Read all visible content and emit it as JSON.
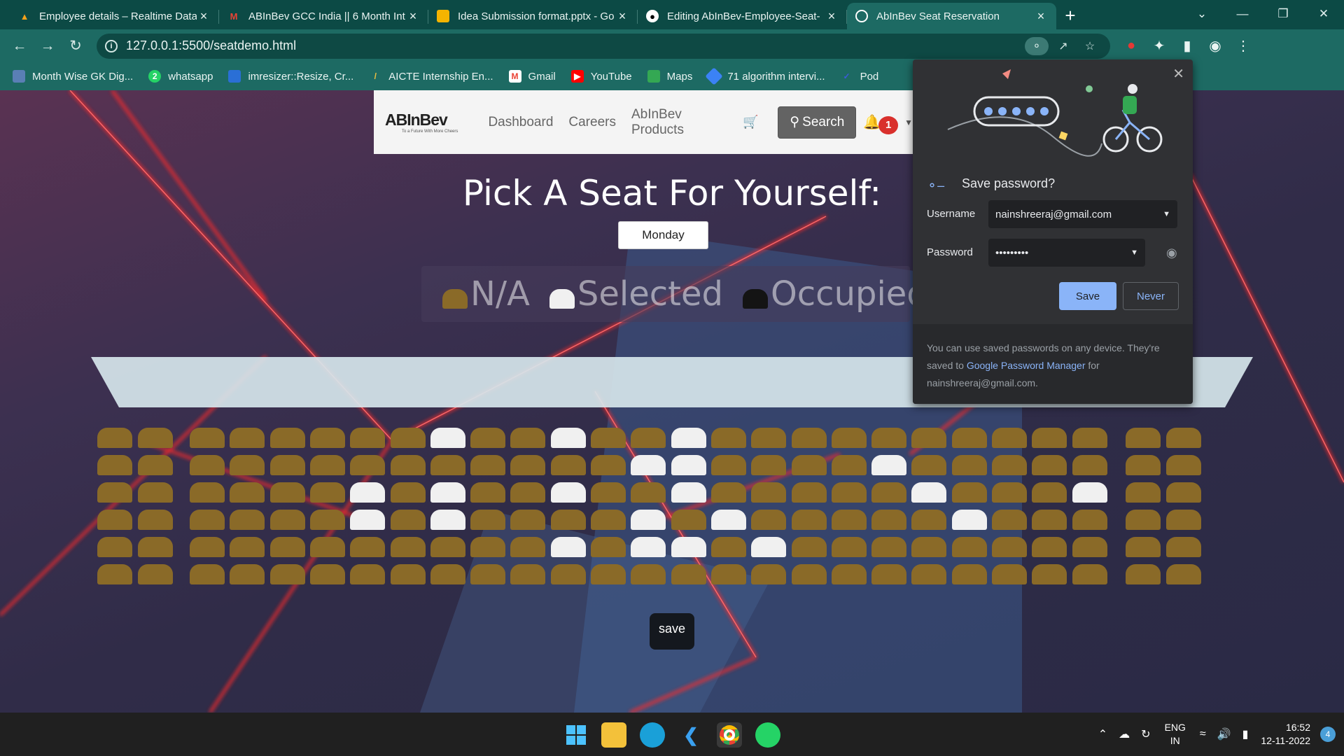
{
  "tabs": [
    {
      "title": "Employee details – Realtime Data",
      "icon": "firebase-icon",
      "color": "#f6a21b"
    },
    {
      "title": "ABInBev GCC India || 6 Month Int",
      "icon": "gmail-icon",
      "color": "#ea4335"
    },
    {
      "title": "Idea Submission format.pptx - Go",
      "icon": "slides-icon",
      "color": "#f4b400"
    },
    {
      "title": "Editing AbInBev-Employee-Seat-",
      "icon": "github-icon",
      "color": "#ffffff"
    },
    {
      "title": "AbInBev Seat Reservation",
      "icon": "globe-icon",
      "color": "#ffffff"
    }
  ],
  "browser": {
    "url": "127.0.0.1:5500/seatdemo.html"
  },
  "bookmarks": [
    {
      "label": "Month Wise GK Dig...",
      "color": "#5a7fb5"
    },
    {
      "label": "whatsapp",
      "color": "#25d366"
    },
    {
      "label": "imresizer::Resize, Cr...",
      "color": "#2a6fd6"
    },
    {
      "label": "AICTE Internship En...",
      "color": "#1d6a63"
    },
    {
      "label": "Gmail",
      "color": "#ea4335"
    },
    {
      "label": "YouTube",
      "color": "#ff0000"
    },
    {
      "label": "Maps",
      "color": "#34a853"
    },
    {
      "label": "71 algorithm intervi...",
      "color": "#3b82f6"
    },
    {
      "label": "Pod",
      "color": "#3b5bdb"
    }
  ],
  "navbar": {
    "logo_text": "ABInBev",
    "logo_tagline": "To a Future With More Cheers",
    "links": [
      "Dashboard",
      "Careers",
      "AbInBev Products"
    ],
    "search_label": "Search",
    "notification_count": "1"
  },
  "page": {
    "title": "Pick A Seat For Yourself:",
    "day": "Monday",
    "save_label": "save"
  },
  "legend": [
    {
      "label": "N/A",
      "color": "#8a6a28"
    },
    {
      "label": "Selected",
      "color": "#f0f0f0"
    },
    {
      "label": "Occupied",
      "color": "#141414"
    }
  ],
  "seat_colors": {
    "na": "#8a6a28",
    "selected": "#f0f0f0"
  },
  "seat_grid": {
    "rows": 6,
    "columns": 27,
    "selected": [
      [
        0,
        8
      ],
      [
        0,
        11
      ],
      [
        0,
        14
      ],
      [
        1,
        13
      ],
      [
        1,
        14
      ],
      [
        1,
        19
      ],
      [
        2,
        6
      ],
      [
        2,
        8
      ],
      [
        2,
        11
      ],
      [
        2,
        14
      ],
      [
        2,
        20
      ],
      [
        2,
        24
      ],
      [
        3,
        6
      ],
      [
        3,
        8
      ],
      [
        3,
        13
      ],
      [
        3,
        15
      ],
      [
        3,
        21
      ],
      [
        4,
        11
      ],
      [
        4,
        13
      ],
      [
        4,
        14
      ],
      [
        4,
        16
      ]
    ]
  },
  "password_popup": {
    "title": "Save password?",
    "username_label": "Username",
    "username": "nainshreeraj@gmail.com",
    "password_label": "Password",
    "password": "•••••••••",
    "save_label": "Save",
    "never_label": "Never",
    "footer_text_1": "You can use saved passwords on any device. They're saved to ",
    "footer_link": "Google Password Manager",
    "footer_text_2": " for nainshreeraj@gmail.com."
  },
  "taskbar": {
    "lang1": "ENG",
    "lang2": "IN",
    "time": "16:52",
    "date": "12-11-2022",
    "notifications": "4"
  }
}
